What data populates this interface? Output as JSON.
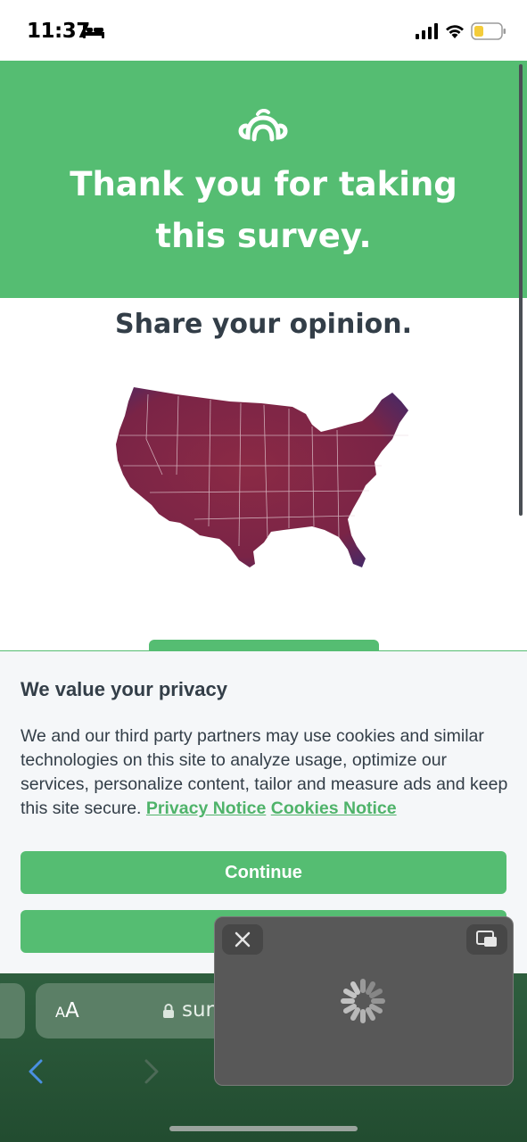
{
  "status_bar": {
    "time": "11:37",
    "icons": [
      "bed-icon",
      "signal-icon",
      "wifi-icon",
      "battery-icon"
    ],
    "battery_color": "#f4cc3a"
  },
  "header": {
    "title": "Thank you for taking this survey.",
    "logo_icon": "surveymonkey-logo-icon",
    "background": "#55bd72"
  },
  "content": {
    "share_title": "Share your opinion.",
    "map_icon": "usa-map-image"
  },
  "privacy": {
    "title": "We value your privacy",
    "body": "We and our third party partners may use cookies and similar technologies on this site to analyze usage, optimize our services, personalize content, tailor and measure ads and keep this site secure.",
    "privacy_link": "Privacy Notice",
    "cookies_link": "Cookies Notice",
    "continue_label": "Continue",
    "accent": "#55bd72"
  },
  "browser": {
    "aa_small": "A",
    "aa_large": "A",
    "url_fragment": "sur",
    "toolbar_color": "#2e5e3e"
  },
  "pip": {
    "close_icon": "close-icon",
    "expand_icon": "pip-expand-icon",
    "spinner_icon": "loading-spinner-icon"
  }
}
